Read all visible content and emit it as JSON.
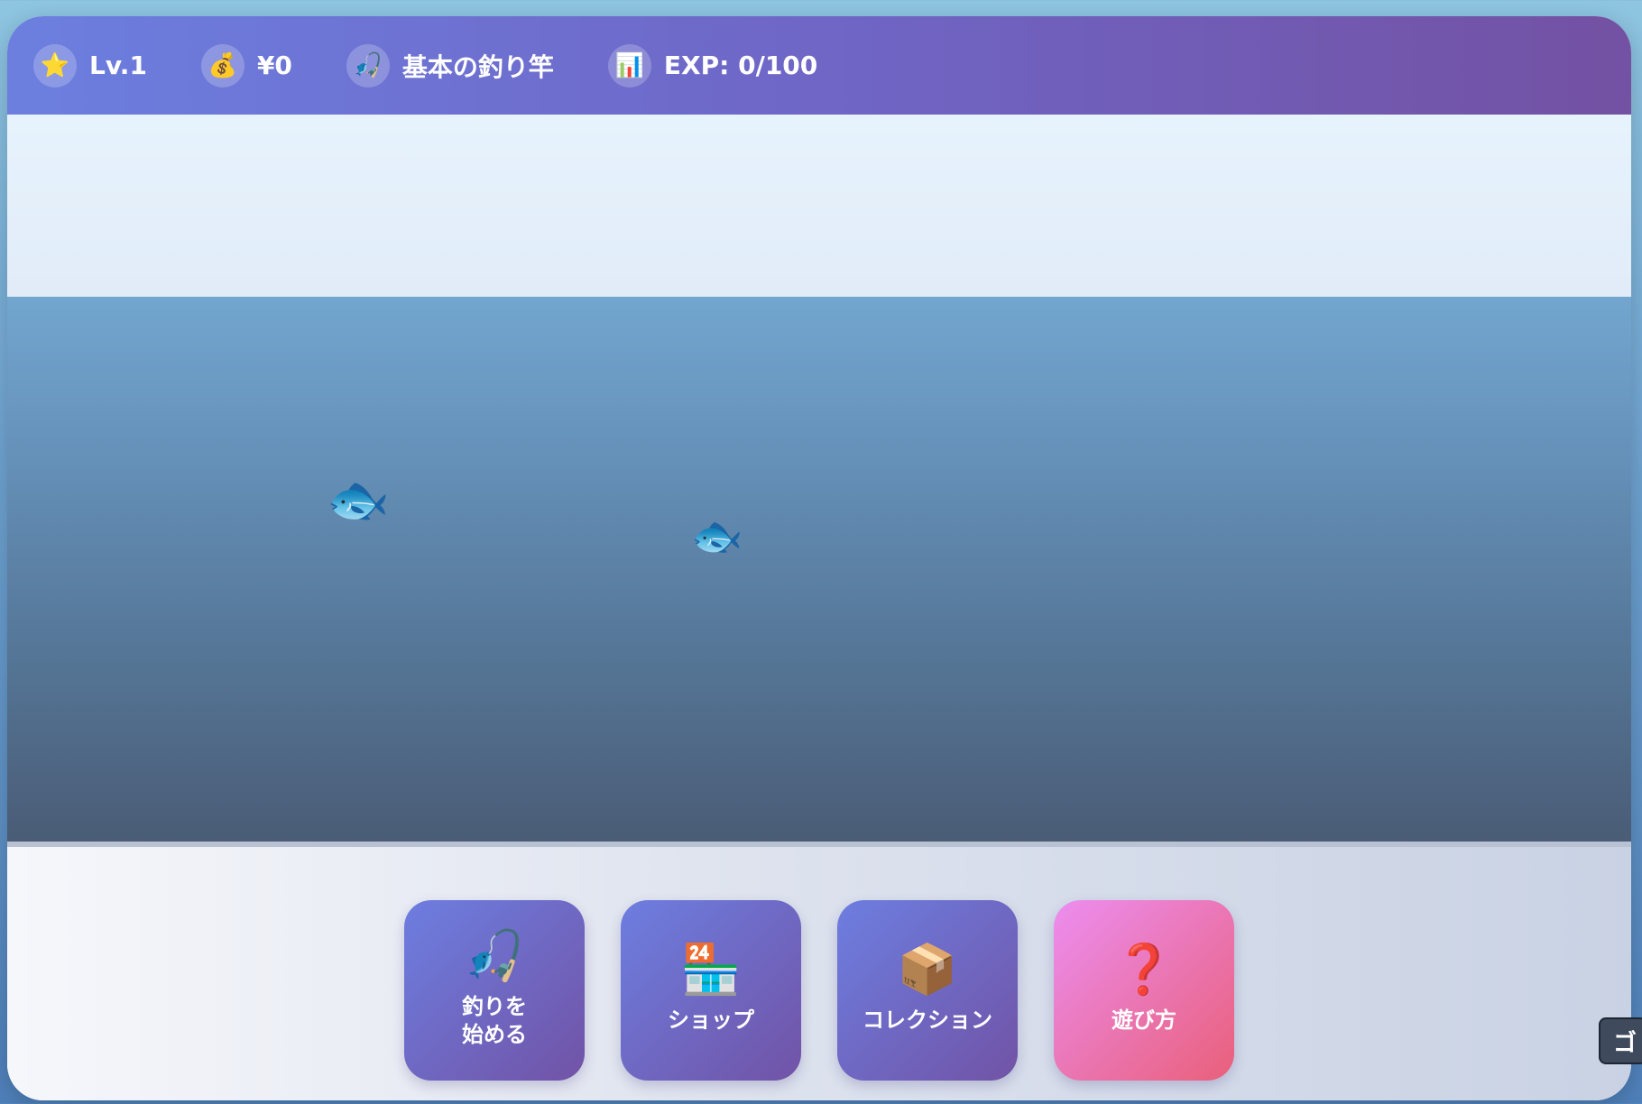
{
  "header": {
    "level": {
      "icon": "star-icon",
      "glyph": "⭐",
      "text": "Lv.1"
    },
    "money": {
      "icon": "money-bag-icon",
      "glyph": "💰",
      "text": "¥0"
    },
    "rod": {
      "icon": "fishing-rod-icon",
      "glyph": "🎣",
      "text": "基本の釣り竿"
    },
    "exp": {
      "icon": "bar-chart-icon",
      "glyph": "📊",
      "text": "EXP: 0/100"
    }
  },
  "water": {
    "fish": [
      {
        "icon": "fish-icon",
        "glyph": "🐟"
      },
      {
        "icon": "fish-icon",
        "glyph": "🐟"
      }
    ]
  },
  "menu": {
    "start_fishing": {
      "icon": "fishing-rod-icon",
      "glyph": "🎣",
      "label": "釣りを\n始める"
    },
    "shop": {
      "icon": "convenience-store-icon",
      "glyph": "🏪",
      "label": "ショップ"
    },
    "collection": {
      "icon": "package-box-icon",
      "glyph": "📦",
      "label": "コレクション"
    },
    "how_to_play": {
      "icon": "question-mark-icon",
      "glyph": "❓",
      "label": "遊び方"
    }
  },
  "corner_tab": {
    "text": "ゴ"
  },
  "colors": {
    "header_start": "#6c7fdf",
    "header_end": "#7351a3",
    "button_purple_start": "#6d7ee0",
    "button_purple_end": "#7153a6",
    "button_pink_start": "#ec8df0",
    "button_pink_end": "#e9607a",
    "water_top": "#72a6cf",
    "water_bottom": "#4a5c76"
  }
}
